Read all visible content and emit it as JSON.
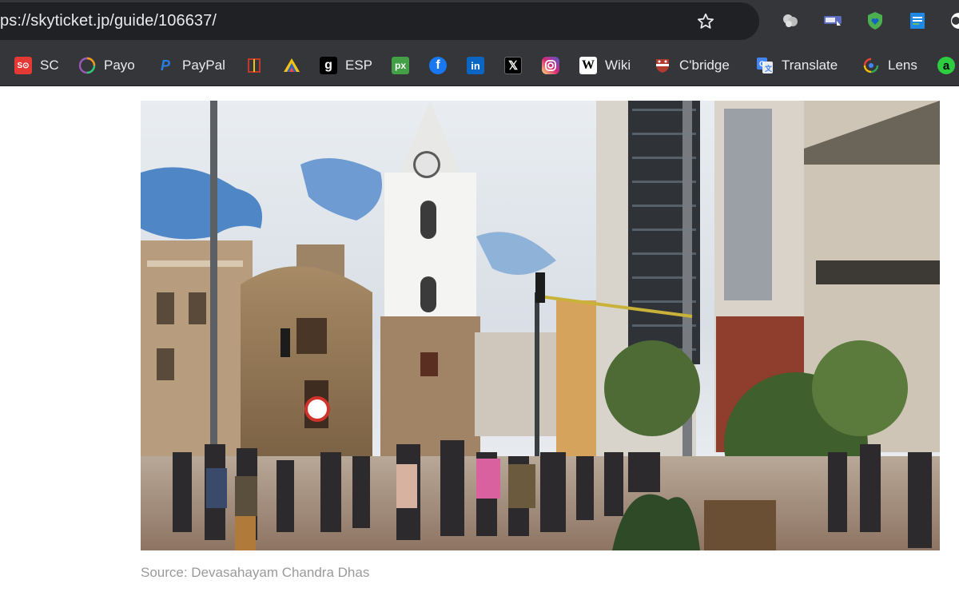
{
  "browser": {
    "url": "ps://skyticket.jp/guide/106637/",
    "bookmark_star_icon": "star-outline-icon",
    "extensions": [
      "puzzle-cloud-icon",
      "cast-icon",
      "shield-heart-icon",
      "document-lines-icon",
      "partial-white-icon"
    ]
  },
  "bookmarks": {
    "items": [
      {
        "label": "SC",
        "icon": "sc-icon",
        "color": "#e53935"
      },
      {
        "label": "Payo",
        "icon": "ring-icon",
        "color": "#8e44ad"
      },
      {
        "label": "PayPal",
        "icon": "paypal-icon",
        "color": "#1e66d0"
      },
      {
        "label": "",
        "icon": "frame-icon",
        "color": "#c0392b"
      },
      {
        "label": "",
        "icon": "triangle-icon",
        "color": "#f1c40f"
      },
      {
        "label": "ESP",
        "icon": "g-icon",
        "color": "#000000"
      },
      {
        "label": "",
        "icon": "px-icon",
        "color": "#43a047"
      },
      {
        "label": "",
        "icon": "facebook-icon",
        "color": "#1877f2"
      },
      {
        "label": "",
        "icon": "linkedin-icon",
        "color": "#0a66c2"
      },
      {
        "label": "",
        "icon": "x-icon",
        "color": "#000000"
      },
      {
        "label": "",
        "icon": "instagram-icon",
        "color": "#d62976"
      },
      {
        "label": "Wiki",
        "icon": "wikipedia-icon",
        "color": "#ffffff"
      },
      {
        "label": "C'bridge",
        "icon": "crest-icon",
        "color": "#b03a2e"
      },
      {
        "label": "Translate",
        "icon": "translate-icon",
        "color": "#4285f4"
      },
      {
        "label": "Lens",
        "icon": "lens-icon",
        "color": "#4285f4"
      },
      {
        "label": "",
        "icon": "a-icon",
        "color": "#2ecc40"
      }
    ]
  },
  "article": {
    "caption": "Source: Devasahayam Chandra Dhas"
  }
}
